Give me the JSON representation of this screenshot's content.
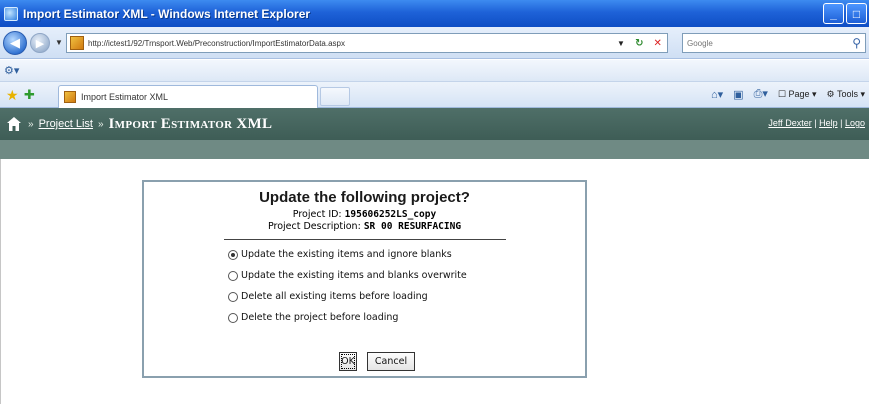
{
  "window": {
    "title": "Import Estimator XML - Windows Internet Explorer",
    "minimize": "_",
    "maximize": "□"
  },
  "address_bar": {
    "url": "http://ictest1/92/Trnsport.Web/Preconstruction/ImportEstimatorData.aspx",
    "search_placeholder": "Google"
  },
  "tab": {
    "title": "Import Estimator XML"
  },
  "command_bar": {
    "page_label": "Page",
    "tools_label": "Tools"
  },
  "app_header": {
    "breadcrumb_sep_1": "»",
    "breadcrumb_link": "Project List",
    "breadcrumb_sep_2": "»",
    "current_page": "Import Estimator XML",
    "user_name": "Jeff Dexter",
    "link_sep_1": "|",
    "help_link": "Help",
    "link_sep_2": "|",
    "logout_link": "Logo"
  },
  "dialog": {
    "heading": "Update the following project?",
    "project_id_label": "Project ID:",
    "project_id_value": "195606252LS_copy",
    "project_desc_label": "Project Description:",
    "project_desc_value": "SR 00 RESURFACING",
    "options": [
      {
        "label": "Update the existing items and ignore blanks",
        "checked": true
      },
      {
        "label": "Update the existing items and blanks overwrite",
        "checked": false
      },
      {
        "label": "Delete all existing items before loading",
        "checked": false
      },
      {
        "label": "Delete the project before loading",
        "checked": false
      }
    ],
    "ok_label": "OK",
    "cancel_label": "Cancel"
  }
}
